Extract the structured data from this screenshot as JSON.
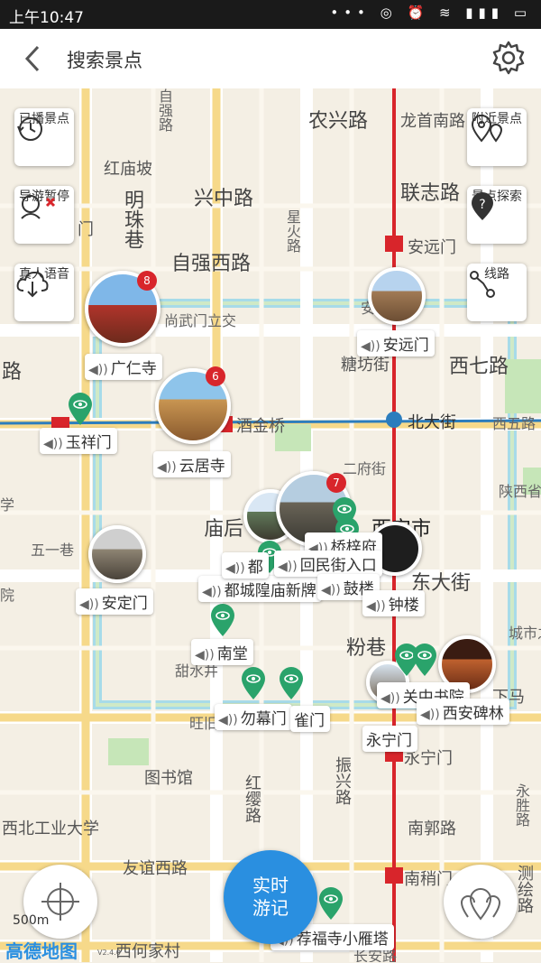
{
  "status_bar": {
    "time": "上午10:47",
    "icons": "••• ◎ ⏰ ≋ ▮▮▮ ▭"
  },
  "header": {
    "title": "搜索景点"
  },
  "side_left": [
    {
      "label": "已播景点",
      "icon": "history-icon"
    },
    {
      "label": "导游暂停",
      "icon": "guide-pause-icon"
    },
    {
      "label": "真人语音",
      "icon": "cloud-download-icon"
    }
  ],
  "side_right": [
    {
      "label": "附近景点",
      "icon": "location-pins-icon"
    },
    {
      "label": "景点探索",
      "icon": "question-pin-icon"
    },
    {
      "label": "线路",
      "icon": "route-icon"
    }
  ],
  "map_labels": {
    "nongxinglu": "农兴路",
    "longshounanlu": "龙首南路",
    "hongmiaopo": "红庙坡",
    "xingzhonglu": "兴中路",
    "lianzhilu": "联志路",
    "mingzhuxiang": "明珠巷",
    "ziqiangxilu": "自强西路",
    "anyuanmen_metro": "安远门",
    "shangwumenlijiao": "尚武门立交",
    "anyuanqiao": "安远门桥",
    "xiqilu": "西七路",
    "tangfangjie": "糖坊街",
    "lu": "路",
    "jiujinqiao": "酒金桥",
    "beidajie": "北大街",
    "xiwulu": "西五路",
    "erfujie": "二府街",
    "shaanxisheng": "陕西省",
    "xian": "西安市",
    "dongdajie": "东大街",
    "xue": "学",
    "wuyixiang": "五一巷",
    "miaohou": "庙后",
    "fenxiang": "粉巷",
    "chengshi": "城市之",
    "tianshuijing": "甜水井",
    "wangji": "旺旧",
    "xiamafang": "下马",
    "yongningmen_metro": "永宁门",
    "tushuguan": "图书馆",
    "xibeigongyedaxue": "西北工业大学",
    "nanguolu": "南郭路",
    "youyixilu": "友谊西路",
    "nanshaomen": "南稍门",
    "xiheijiacun": "西何家村",
    "changan": "长安路",
    "hongyinglu": "红缨路",
    "zhenxinglu": "振兴路",
    "yongshenglu": "永胜路",
    "cihuilu": "测绘路",
    "yuanwu": "院",
    "beiyuan": "院",
    "xiaozhai": "自强路",
    "guangjiexin": "星火路",
    "xixiangsi": "门",
    "xiao": "小"
  },
  "spots": [
    {
      "name": "广仁寺",
      "badge": "8"
    },
    {
      "name": "云居寺",
      "badge": "6"
    },
    {
      "name": "玉祥门"
    },
    {
      "name": "安远门"
    },
    {
      "name": "安定门"
    },
    {
      "name": "都城隍庙新牌"
    },
    {
      "name": "都"
    },
    {
      "name": "回民街入口"
    },
    {
      "name": "鼓楼"
    },
    {
      "name": "钟楼"
    },
    {
      "name": "桥梓府"
    },
    {
      "name": "南堂"
    },
    {
      "name": "勿幕门"
    },
    {
      "name": "雀门"
    },
    {
      "name": "关中书院"
    },
    {
      "name": "西安碑林"
    },
    {
      "name": "永宁门"
    },
    {
      "name": "荐福寺小雁塔"
    },
    {
      "name": "7"
    }
  ],
  "fab": {
    "line1": "实时",
    "line2": "游记"
  },
  "map_footer": {
    "scale": "500m",
    "logo": "高德地图",
    "version": "V2.4.0"
  },
  "colors": {
    "metro": "#d8252b",
    "water": "#9fd6e6",
    "park": "#c6e6b8",
    "road": "#ffffff",
    "pin": "#2aa36b",
    "fab": "#2a8fe0"
  }
}
